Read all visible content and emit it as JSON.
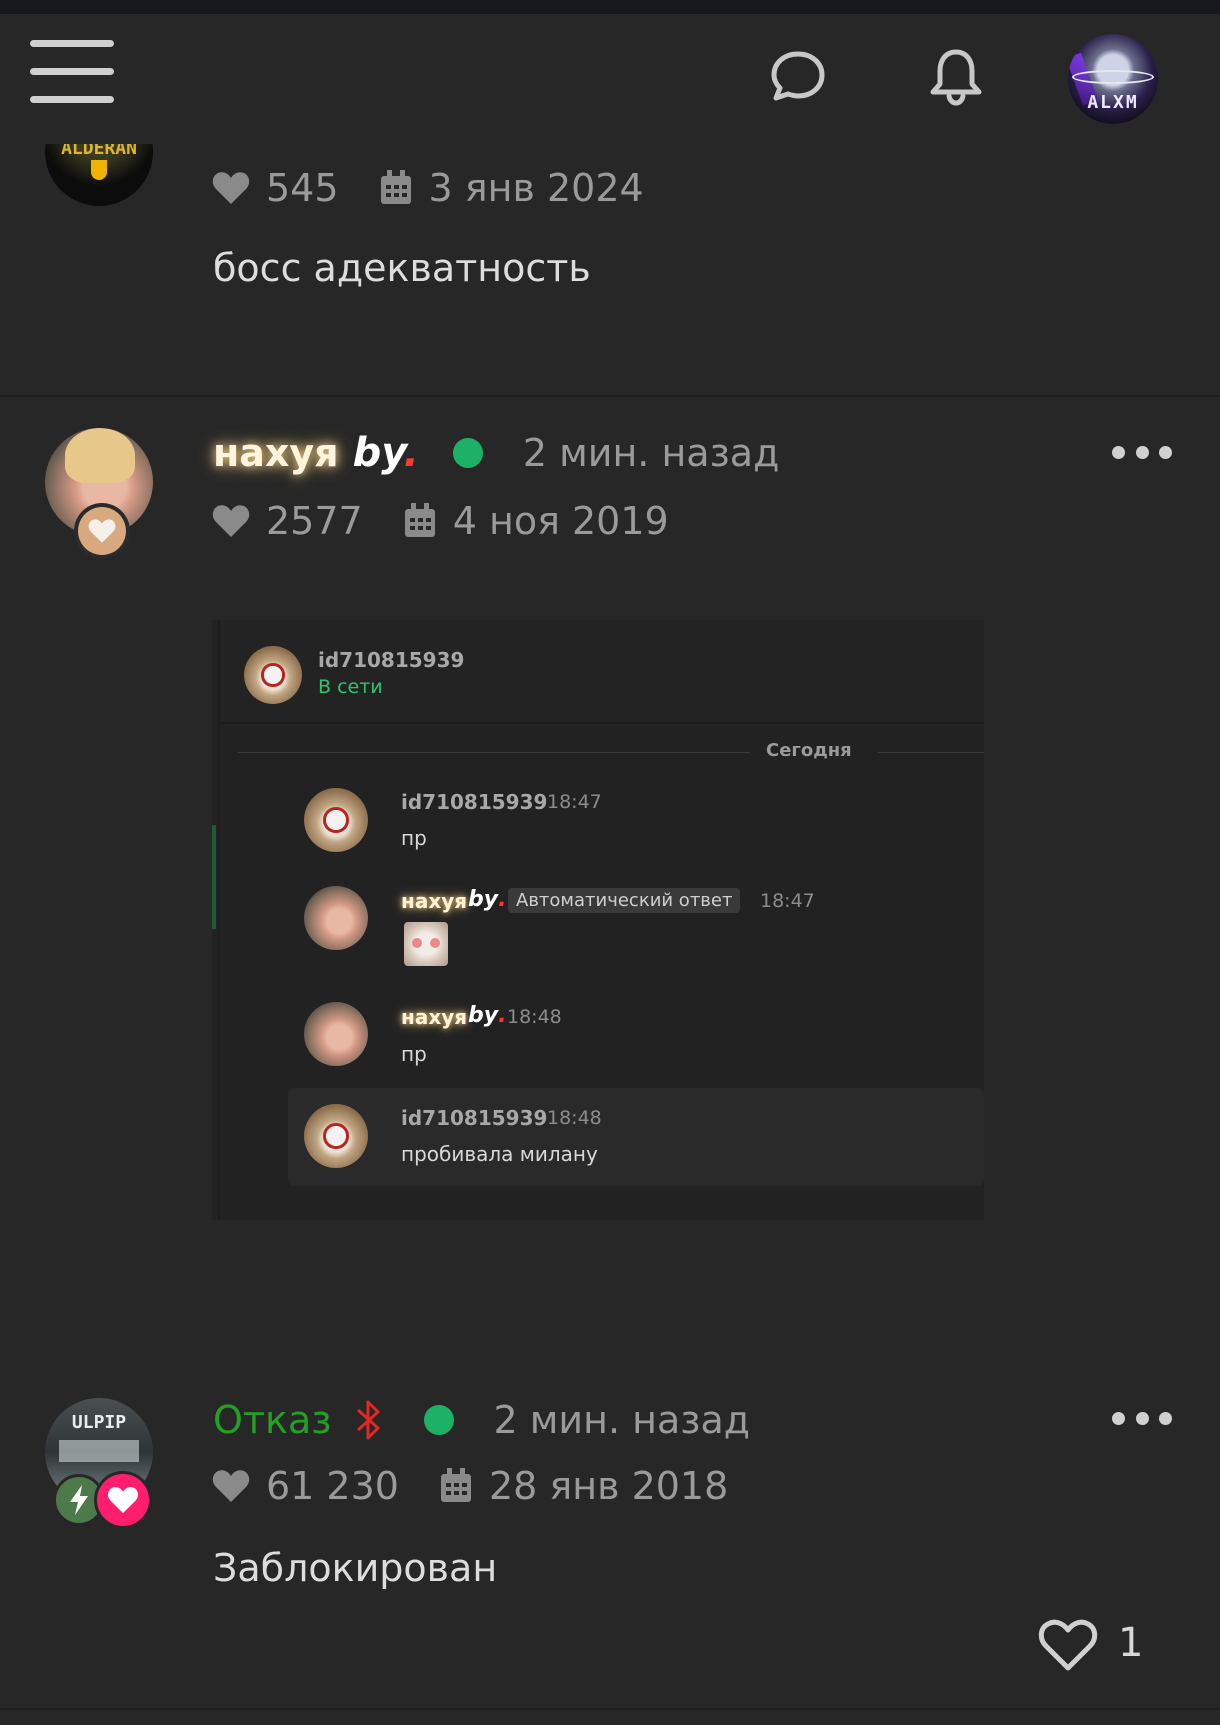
{
  "header": {
    "menu_icon": "hamburger-icon",
    "chat_icon": "chat-bubble-icon",
    "bell_icon": "bell-icon",
    "avatar_text": "ALXM"
  },
  "comments": [
    {
      "avatar_text": "ALDERAN",
      "likes": "545",
      "date": "3 янв 2024",
      "text": "босс адекватность"
    },
    {
      "name": "нахуя",
      "by_label": "by",
      "by_dot": ".",
      "online_color": "#1db168",
      "ago": "2 мин. назад",
      "likes": "2577",
      "date": "4 ноя 2019",
      "embedded_chat": {
        "header_user": "id710815939",
        "header_status": "В сети",
        "day_separator": "Сегодня",
        "messages": [
          {
            "user": "id710815939",
            "time": "18:47",
            "text": "пр"
          },
          {
            "user": "нахуя",
            "by": "by",
            "badge": "Автоматический ответ",
            "time": "18:47",
            "text": ""
          },
          {
            "user": "нахуя",
            "by": "by",
            "time": "18:48",
            "text": "пр"
          },
          {
            "user": "id710815939",
            "time": "18:48",
            "text": "пробивала милану"
          }
        ]
      }
    },
    {
      "name": "Отказ",
      "name_color": "#22a124",
      "online_color": "#1db168",
      "ago": "2 мин. назад",
      "likes": "61 230",
      "date": "28 янв 2018",
      "text": "Заблокирован",
      "avatar_text": "ULPIP",
      "comment_likes": "1"
    }
  ]
}
